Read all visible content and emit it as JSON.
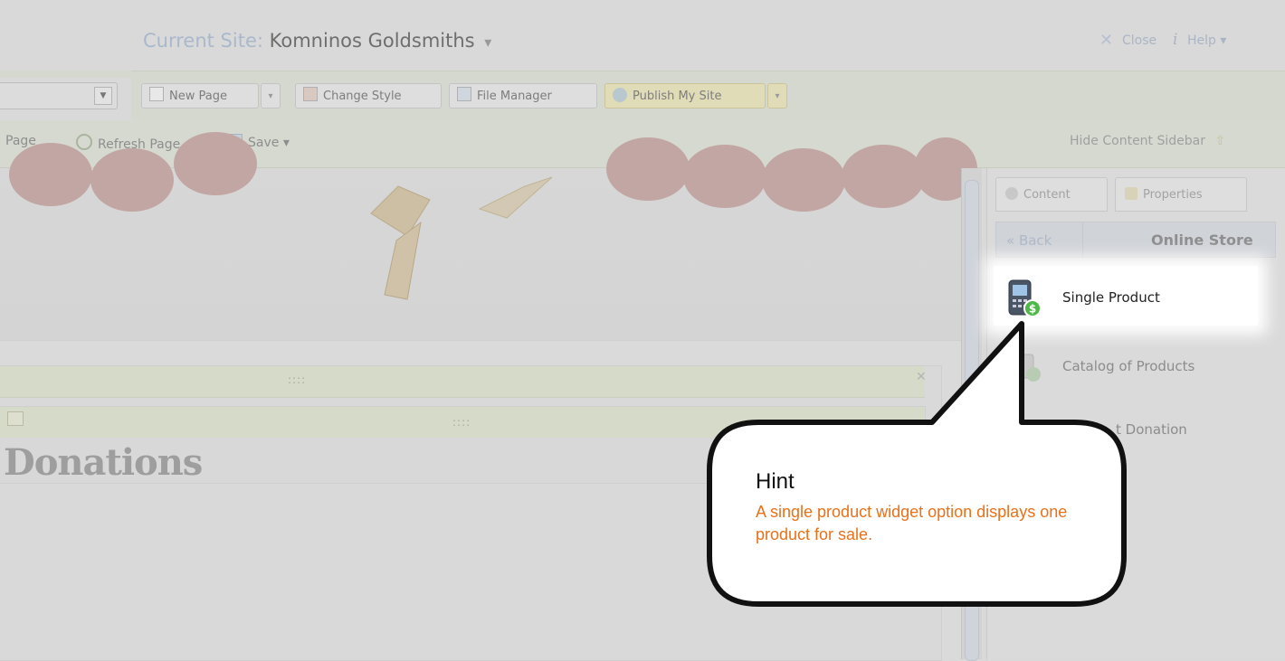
{
  "header": {
    "site_label": "Current Site:",
    "site_name": "Komninos Goldsmiths",
    "close_label": "Close",
    "help_label": "Help",
    "info_icon": "i"
  },
  "toolbar": {
    "new_page": "New Page",
    "change_style": "Change Style",
    "file_manager": "File Manager",
    "publish": "Publish My Site"
  },
  "subbar": {
    "page_partial": "Page",
    "refresh": "Refresh Page",
    "save": "Save",
    "hide_sidebar": "Hide Content Sidebar"
  },
  "canvas": {
    "heading": "Donations",
    "grip": "::::"
  },
  "sidebar": {
    "tabs": [
      {
        "label": "Content"
      },
      {
        "label": "Properties"
      }
    ],
    "back": "« Back",
    "title": "Online Store",
    "items": [
      {
        "label": "Single Product"
      },
      {
        "label": "Catalog of Products"
      },
      {
        "label": "t Donation"
      }
    ]
  },
  "hint": {
    "title": "Hint",
    "body": "A single product widget option displays one product for sale."
  }
}
